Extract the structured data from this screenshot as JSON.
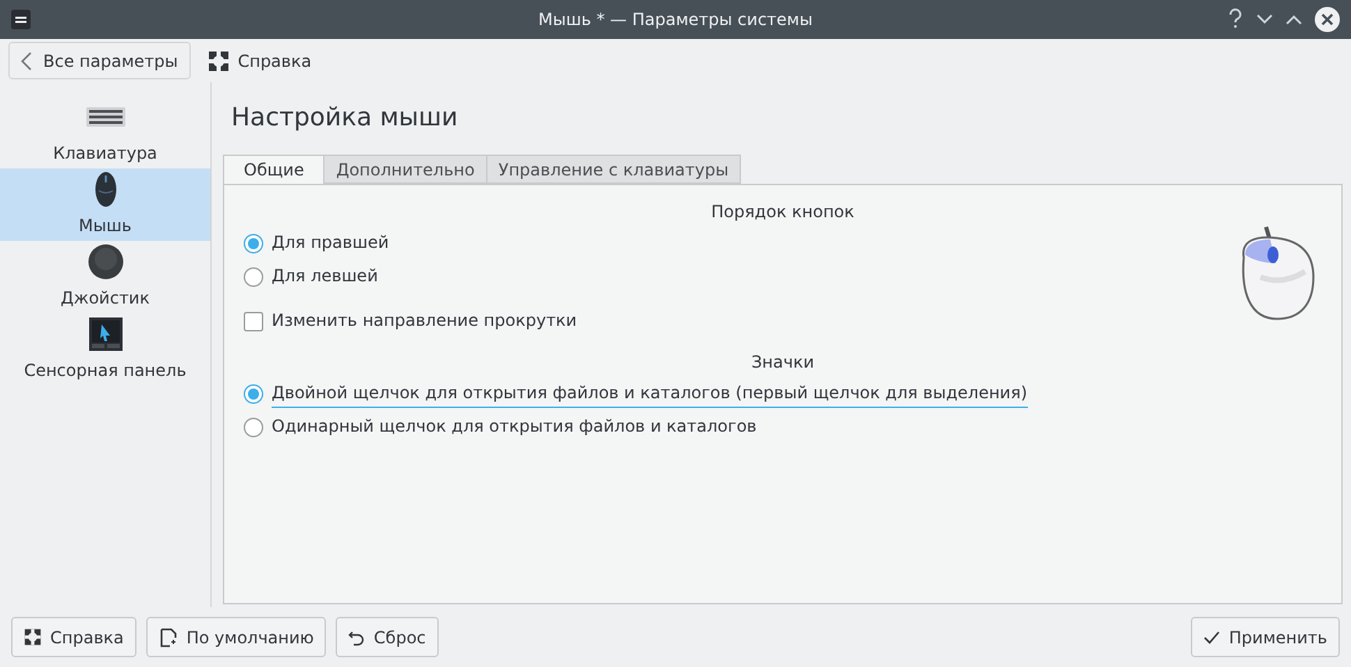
{
  "window": {
    "title": "Мышь * — Параметры системы"
  },
  "toolbar": {
    "back_button": "Все параметры",
    "help_button": "Справка"
  },
  "sidebar": {
    "items": [
      {
        "kind": "keyboard",
        "label": "Клавиатура",
        "selected": false
      },
      {
        "kind": "mouse",
        "label": "Мышь",
        "selected": true
      },
      {
        "kind": "joystick",
        "label": "Джойстик",
        "selected": false
      },
      {
        "kind": "touchpad",
        "label": "Сенсорная панель",
        "selected": false
      }
    ]
  },
  "page_title": "Настройка мыши",
  "tabs": [
    {
      "label": "Общие",
      "selected": true
    },
    {
      "label": "Дополнительно",
      "selected": false
    },
    {
      "label": "Управление с клавиатуры",
      "selected": false
    }
  ],
  "sections": [
    {
      "title": "Порядок кнопок",
      "options": [
        {
          "kind": "radio",
          "label": "Для правшей",
          "checked": true,
          "focused": false
        },
        {
          "kind": "radio",
          "label": "Для левшей",
          "checked": false,
          "focused": false
        },
        {
          "kind": "checkbox",
          "label": "Изменить направление прокрутки",
          "checked": false,
          "focused": false
        }
      ]
    },
    {
      "title": "Значки",
      "options": [
        {
          "kind": "radio",
          "label": "Двойной щелчок для открытия файлов и каталогов (первый щелчок для выделения)",
          "checked": true,
          "focused": true
        },
        {
          "kind": "radio",
          "label": "Одинарный щелчок для открытия файлов и каталогов",
          "checked": false,
          "focused": false
        }
      ]
    }
  ],
  "footer_buttons": [
    {
      "kind": "help",
      "label": "Справка"
    },
    {
      "kind": "defaults",
      "label": "По умолчанию"
    },
    {
      "kind": "reset",
      "label": "Сброс"
    },
    {
      "kind": "apply",
      "label": "Применить"
    }
  ]
}
